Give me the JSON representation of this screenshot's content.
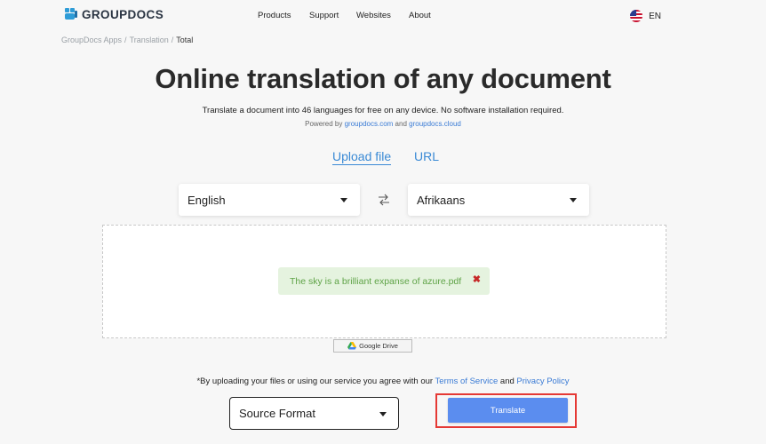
{
  "header": {
    "logo_text": "GROUPDOCS",
    "nav": [
      "Products",
      "Support",
      "Websites",
      "About"
    ],
    "language": "EN"
  },
  "breadcrumb": [
    "GroupDocs Apps",
    "Translation",
    "Total"
  ],
  "hero": {
    "title": "Online translation of any document",
    "subtitle": "Translate a document into 46 languages for free on any device. No software installation required.",
    "powered_prefix": "Powered by",
    "powered_link1": "groupdocs.com",
    "powered_and": "and",
    "powered_link2": "groupdocs.cloud"
  },
  "tabs": {
    "upload": "Upload file",
    "url": "URL"
  },
  "source_language": "English",
  "target_language": "Afrikaans",
  "file": {
    "name": "The sky is a brilliant expanse of azure.pdf",
    "remove_glyph": "✖"
  },
  "google_drive_label": "Google Drive",
  "agreement": {
    "prefix": "*By uploading your files or using our service you agree with our",
    "terms": "Terms of Service",
    "and": "and",
    "privacy": "Privacy Policy"
  },
  "format_select": "Source Format",
  "translate_button": "Translate",
  "colors": {
    "accent_blue": "#3a8ad5",
    "button_blue": "#5b8def",
    "success_bg": "#e5f3df",
    "success_text": "#5fa347",
    "highlight_red": "#e53935"
  }
}
